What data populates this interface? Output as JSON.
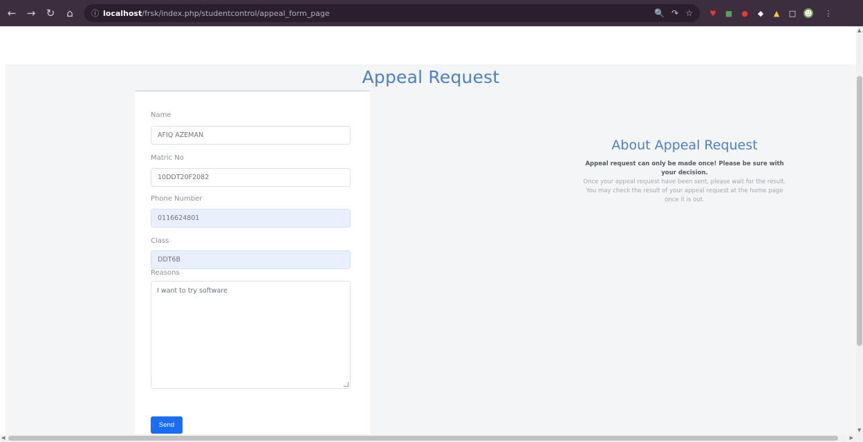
{
  "browser": {
    "url_host": "localhost",
    "url_path": "/frsk/index.php/studentcontrol/appeal_form_page",
    "back_icon": "arrow-left-icon",
    "forward_icon": "arrow-right-icon",
    "reload_icon": "reload-icon",
    "home_icon": "home-icon"
  },
  "page": {
    "title": "Appeal Request"
  },
  "form": {
    "name_label": "Name",
    "name_value": "AFIQ AZEMAN",
    "matric_label": "Matric No",
    "matric_value": "10DDT20F2082",
    "phone_label": "Phone Number",
    "phone_value": "0116624801",
    "class_label": "Class",
    "class_value": "DDT6B",
    "reasons_label": "Reasons",
    "reasons_value": "I want to try software",
    "send_label": "Send"
  },
  "about": {
    "heading": "About Appeal Request",
    "bold_text": "Appeal request can only be made once! Please be sure with your decision.",
    "body_text": "Once your appeal request have been sent, please wait for the result. You may check the result of your appeal request at the home page once it is out."
  },
  "colors": {
    "accent": "#4a7fd0",
    "button": "#1a6ef5",
    "toolbar": "#3c2d3f"
  }
}
